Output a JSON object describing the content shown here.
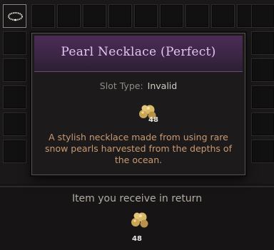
{
  "tooltip": {
    "title": "Pearl Necklace (Perfect)",
    "slot_type_label": "Slot Type:",
    "slot_type_value": "Invalid",
    "material_icon": "pearl-cluster-icon",
    "material_count": "48",
    "description": "A stylish necklace made from using rare snow pearls harvested from the depths of the ocean."
  },
  "inventory": {
    "selected_item_icon": "necklace-icon"
  },
  "return_section": {
    "label": "Item you receive in return",
    "icon": "pearl-cluster-icon",
    "count": "48"
  },
  "colors": {
    "title": "#e4c4f2",
    "header_bg": "#4a2c55",
    "description": "#c99a72"
  }
}
